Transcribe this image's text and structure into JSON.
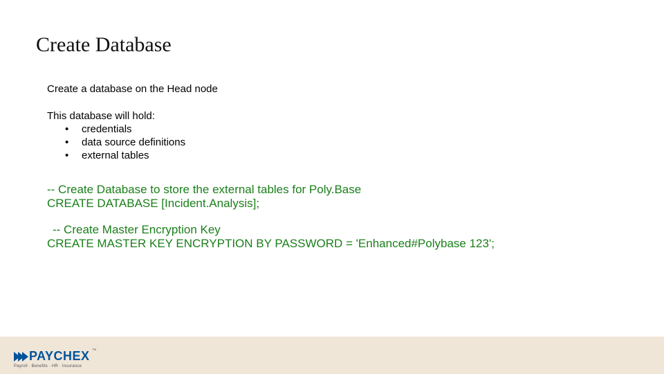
{
  "title": "Create Database",
  "lead": "Create a database on the Head node",
  "sub": "This database will hold:",
  "bullets": [
    "credentials",
    "data source definitions",
    "external tables"
  ],
  "code1": {
    "comment": "-- Create Database to store the external tables for Poly.Base",
    "stmt": "CREATE DATABASE [Incident.Analysis];"
  },
  "code2": {
    "comment": " -- Create Master Encryption Key",
    "stmt": "CREATE MASTER KEY ENCRYPTION BY PASSWORD = 'Enhanced#Polybase 123';"
  },
  "logo": {
    "text": "PAYCHEX",
    "sub": "Payroll · Benefits · HR · Insurance"
  }
}
